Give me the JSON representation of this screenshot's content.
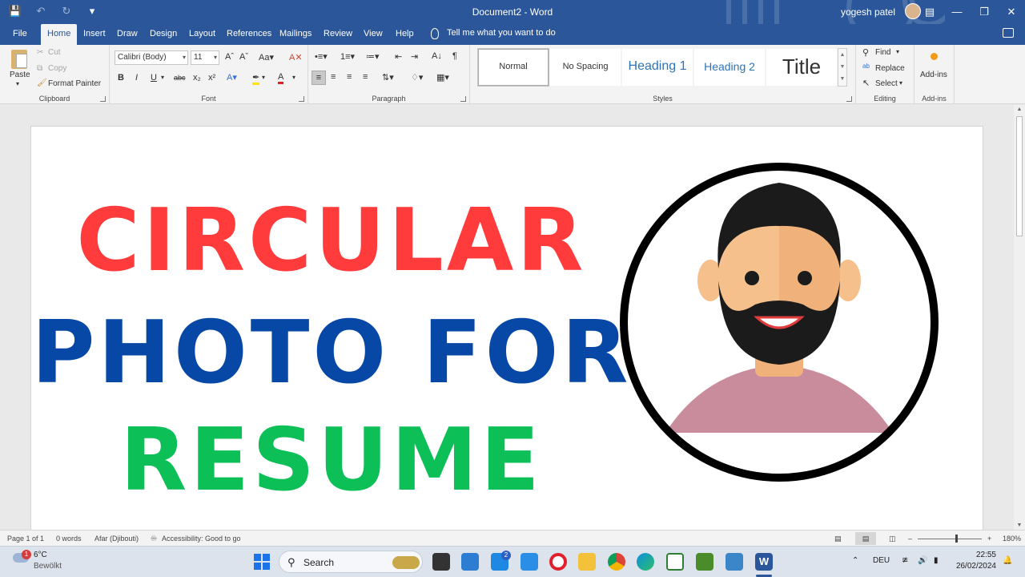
{
  "window": {
    "title": "Document2  -  Word",
    "user_name": "yogesh patel"
  },
  "tabs": {
    "file": "File",
    "home": "Home",
    "insert": "Insert",
    "draw": "Draw",
    "design": "Design",
    "layout": "Layout",
    "references": "References",
    "mailings": "Mailings",
    "review": "Review",
    "view": "View",
    "help": "Help",
    "tell_me": "Tell me what you want to do"
  },
  "ribbon": {
    "clipboard": {
      "label": "Clipboard",
      "paste": "Paste",
      "cut": "Cut",
      "copy": "Copy",
      "format_painter": "Format Painter"
    },
    "font": {
      "label": "Font",
      "font_name": "Calibri (Body)",
      "font_size": "11"
    },
    "paragraph": {
      "label": "Paragraph"
    },
    "styles": {
      "label": "Styles",
      "items": [
        "Normal",
        "No Spacing",
        "Heading 1",
        "Heading 2",
        "Title"
      ]
    },
    "editing": {
      "label": "Editing",
      "find": "Find",
      "replace": "Replace",
      "select": "Select"
    },
    "addins": {
      "label": "Add-ins",
      "button": "Add-ins"
    }
  },
  "document": {
    "line1": "CIRCULAR",
    "line2": "PHOTO FOR",
    "line3": "RESUME",
    "colors": {
      "line1": "#ff3b3b",
      "line2": "#0747a6",
      "line3": "#0cbf57"
    }
  },
  "status": {
    "page": "Page 1 of 1",
    "words": "0 words",
    "language": "Afar (Djibouti)",
    "accessibility": "Accessibility: Good to go",
    "zoom": "180%"
  },
  "taskbar": {
    "temperature": "6°C",
    "condition": "Bewölkt",
    "weather_badge": "1",
    "search": "Search",
    "mail_badge": "2",
    "input_lang": "DEU",
    "time": "22:55",
    "date": "26/02/2024"
  }
}
